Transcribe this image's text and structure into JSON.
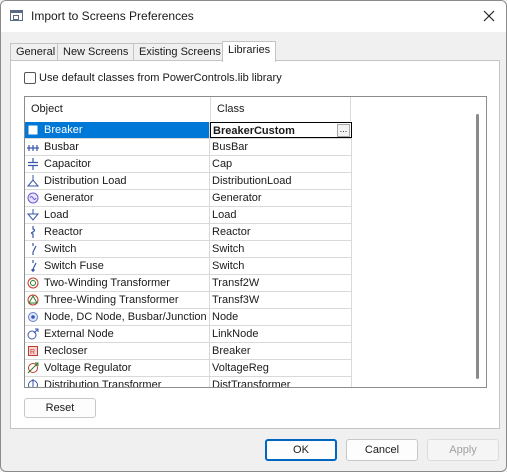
{
  "window": {
    "title": "Import to Screens Preferences"
  },
  "tabs": [
    {
      "label": "General",
      "active": false
    },
    {
      "label": "New Screens",
      "active": false
    },
    {
      "label": "Existing Screens",
      "active": false
    },
    {
      "label": "Libraries",
      "active": true
    }
  ],
  "libraries": {
    "use_default_label": "Use default classes from PowerControls.lib library",
    "use_default_checked": false,
    "columns": {
      "object": "Object",
      "class": "Class"
    },
    "rows": [
      {
        "object": "Breaker",
        "class": "BreakerCustom",
        "icon": "breaker-icon",
        "selected": true
      },
      {
        "object": "Busbar",
        "class": "BusBar",
        "icon": "busbar-icon"
      },
      {
        "object": "Capacitor",
        "class": "Cap",
        "icon": "capacitor-icon"
      },
      {
        "object": "Distribution Load",
        "class": "DistributionLoad",
        "icon": "distribution-load-icon"
      },
      {
        "object": "Generator",
        "class": "Generator",
        "icon": "generator-icon"
      },
      {
        "object": "Load",
        "class": "Load",
        "icon": "load-icon"
      },
      {
        "object": "Reactor",
        "class": "Reactor",
        "icon": "reactor-icon"
      },
      {
        "object": "Switch",
        "class": "Switch",
        "icon": "switch-icon"
      },
      {
        "object": "Switch Fuse",
        "class": "Switch",
        "icon": "switch-fuse-icon"
      },
      {
        "object": "Two-Winding Transformer",
        "class": "Transf2W",
        "icon": "two-winding-transformer-icon"
      },
      {
        "object": "Three-Winding Transformer",
        "class": "Transf3W",
        "icon": "three-winding-transformer-icon"
      },
      {
        "object": "Node, DC Node, Busbar/Junction",
        "class": "Node",
        "icon": "node-icon"
      },
      {
        "object": "External Node",
        "class": "LinkNode",
        "icon": "external-node-icon"
      },
      {
        "object": "Recloser",
        "class": "Breaker",
        "icon": "recloser-icon"
      },
      {
        "object": "Voltage Regulator",
        "class": "VoltageReg",
        "icon": "voltage-regulator-icon"
      },
      {
        "object": "Distribution Transformer",
        "class": "DistTransformer",
        "icon": "distribution-transformer-icon"
      }
    ],
    "browse_label": "...",
    "reset_label": "Reset"
  },
  "buttons": {
    "ok": "OK",
    "cancel": "Cancel",
    "apply": "Apply"
  },
  "colors": {
    "selection": "#0078d7",
    "default_button_border": "#0067c0"
  }
}
